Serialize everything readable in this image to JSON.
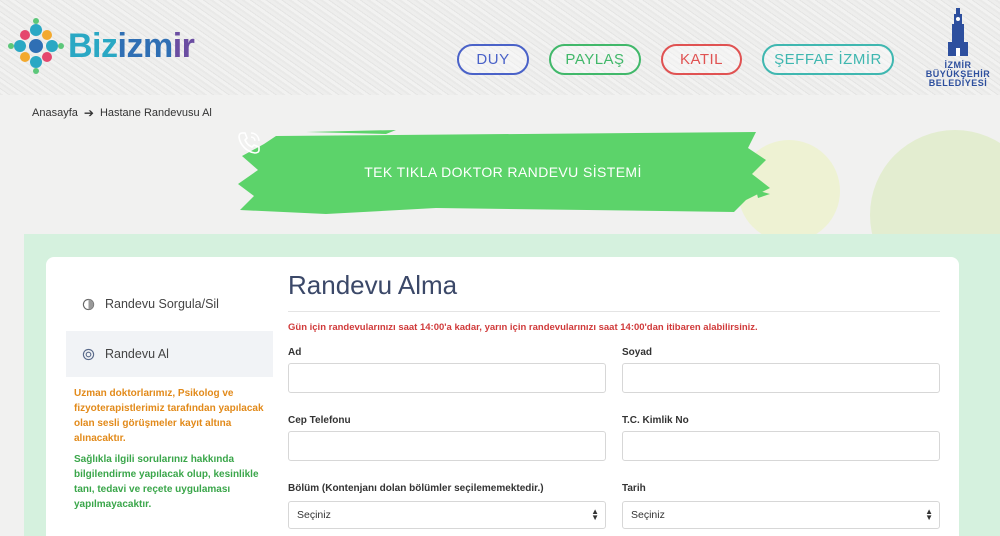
{
  "header": {
    "logo": {
      "part1": "Biz",
      "part2": "izm",
      "part3": "ir"
    },
    "nav": [
      "DUY",
      "PAYLAŞ",
      "KATIL",
      "ŞEFFAF İZMİR"
    ],
    "belediye": {
      "line1": "İZMİR",
      "line2": "BÜYÜKŞEHİR",
      "line3": "BELEDİYESİ"
    }
  },
  "breadcrumb": {
    "home": "Anasayfa",
    "current": "Hastane Randevusu Al"
  },
  "banner": {
    "text": "TEK TIKLA DOKTOR RANDEVU SİSTEMİ",
    "color": "#5cd36a"
  },
  "sidebar": {
    "items": [
      "Randevu Sorgula/Sil",
      "Randevu Al"
    ],
    "info_orange": "Uzman doktorlarımız, Psikolog ve fizyoterapistlerimiz tarafından yapılacak olan sesli görüşmeler kayıt altına alınacaktır.",
    "info_green": "Sağlıkla ilgili sorularınız hakkında bilgilendirme yapılacak olup, kesinlikle tanı, tedavi ve reçete uygulaması yapılmayacaktır."
  },
  "form": {
    "title": "Randevu Alma",
    "warning": "Gün için randevularınızı saat 14:00'a kadar, yarın için randevularınızı saat 14:00'dan itibaren alabilirsiniz.",
    "labels": {
      "ad": "Ad",
      "soyad": "Soyad",
      "telefon": "Cep Telefonu",
      "tc": "T.C. Kimlik No",
      "bolum": "Bölüm (Kontenjanı dolan bölümler seçilememektedir.)",
      "tarih": "Tarih"
    },
    "values": {
      "ad": "",
      "soyad": "",
      "telefon": "",
      "tc": ""
    },
    "bolum_selected": "Seçiniz",
    "tarih_selected": "Seçiniz"
  },
  "colors": {
    "accent_green": "#5cd36a",
    "main_bg": "#d5f1de",
    "title": "#3b4868",
    "warning": "#d03a3a"
  }
}
